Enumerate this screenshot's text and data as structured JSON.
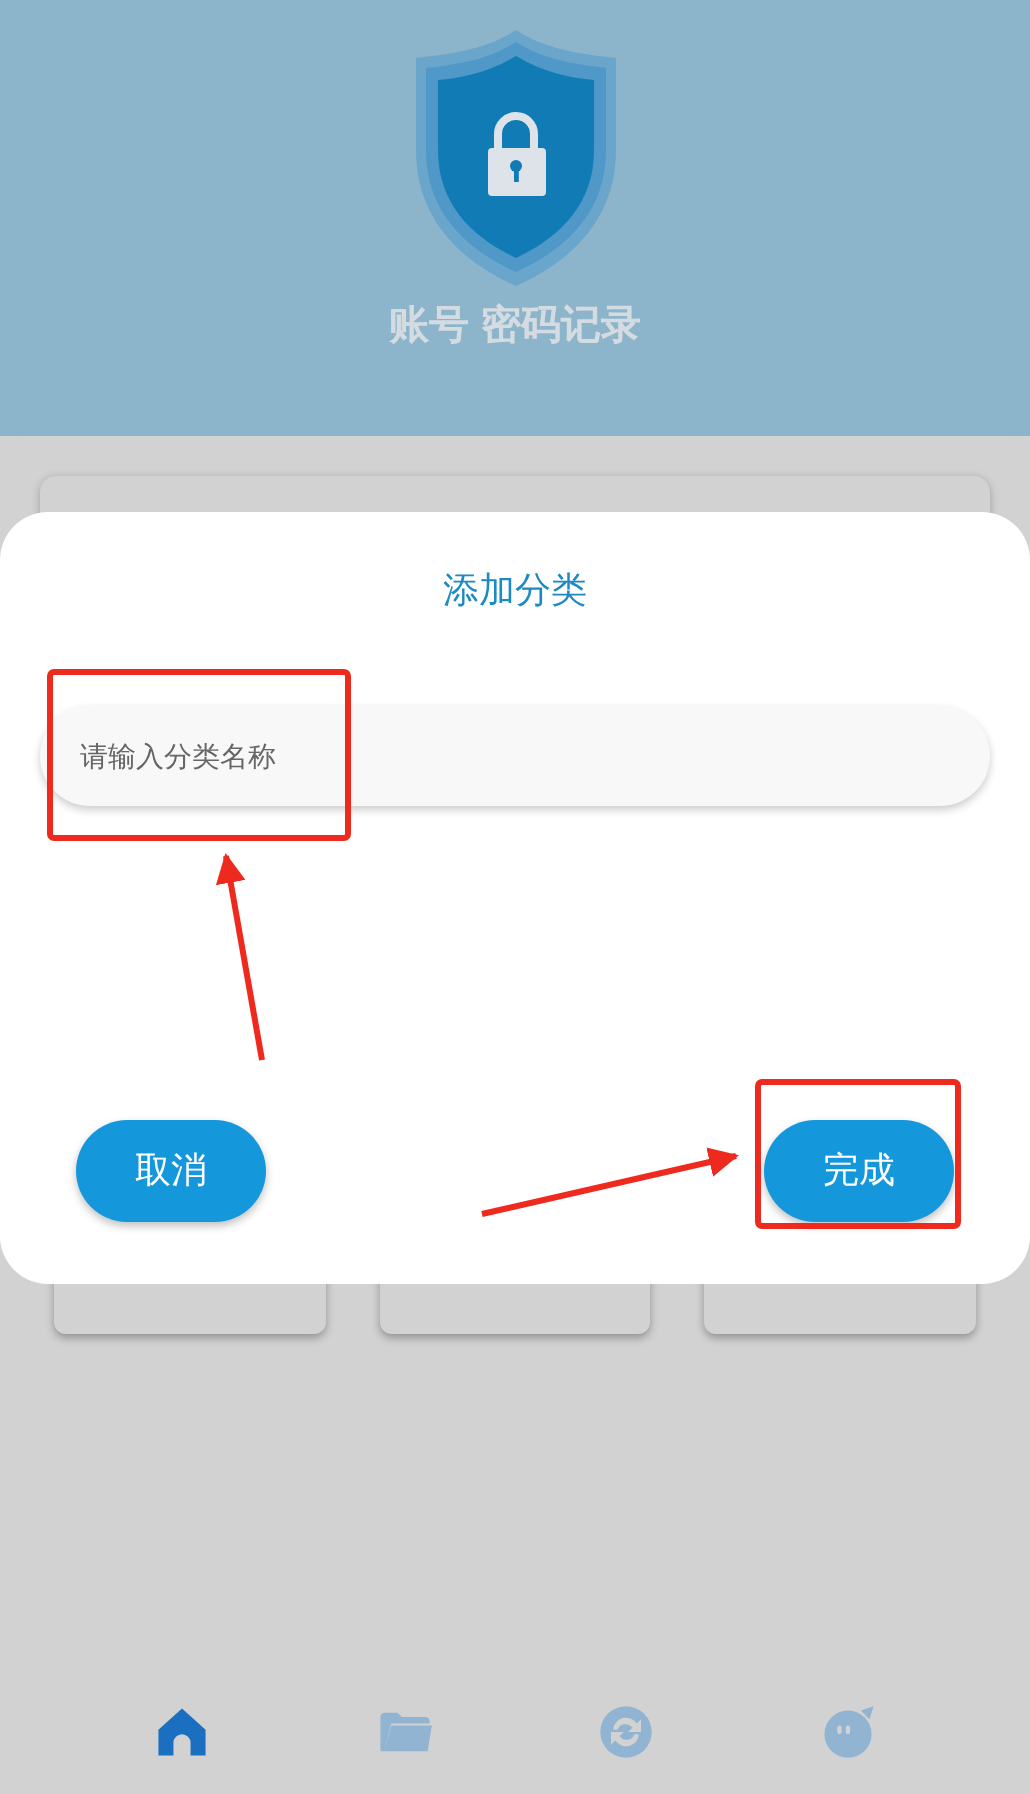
{
  "header": {
    "title": "账号 密码记录"
  },
  "dialog": {
    "title": "添加分类",
    "input": {
      "placeholder": "请输入分类名称"
    },
    "buttons": [
      "取消",
      "完成"
    ]
  },
  "nav": [
    {
      "kind": "home",
      "selected": true
    },
    {
      "kind": "folder",
      "selected": false
    },
    {
      "kind": "sync",
      "selected": false
    },
    {
      "kind": "chat",
      "selected": false
    }
  ]
}
